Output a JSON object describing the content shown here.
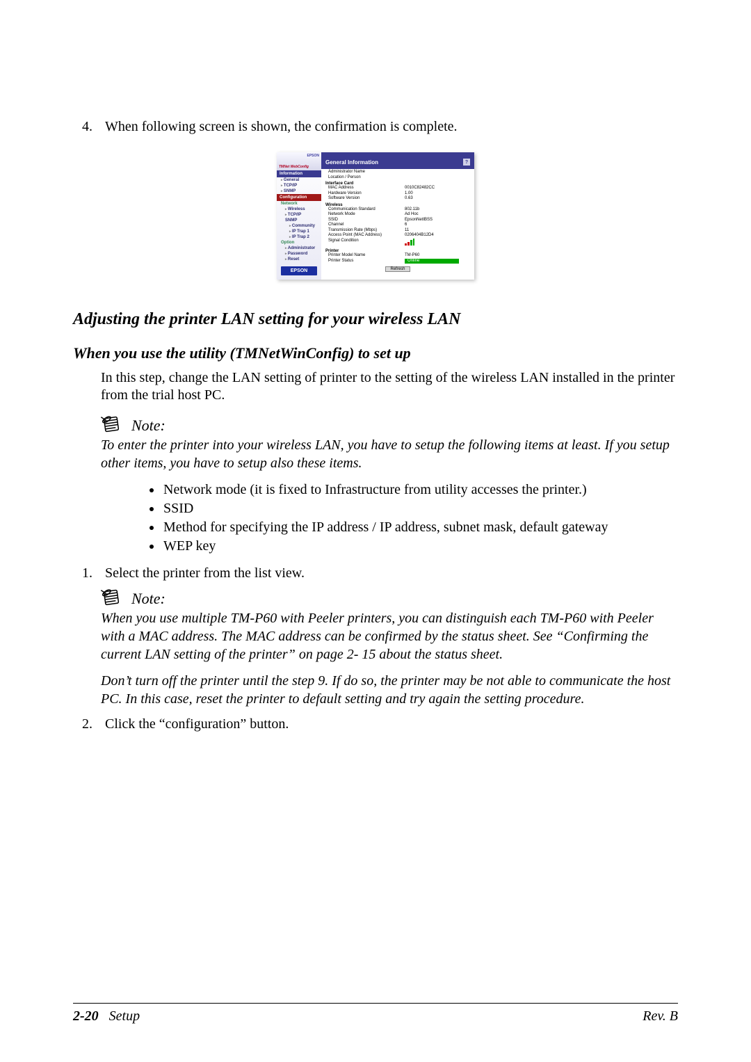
{
  "step4": {
    "num": "4.",
    "text": "When following screen is shown, the confirmation is complete."
  },
  "screenshot": {
    "logo_brand": "EPSON",
    "logo_product": "TMNet WebConfig",
    "side": {
      "info_h": "Information",
      "general": "General",
      "tcpip": "TCP/IP",
      "snmp": "SNMP",
      "config_h": "Configuration",
      "network": "Network",
      "wireless": "Wireless",
      "tcpip2": "TCP/IP",
      "snmp2": "SNMP",
      "community": "Community",
      "iptrap1": "IP Trap 1",
      "iptrap2": "IP Trap 2",
      "option": "Option",
      "admin": "Administrator",
      "password": "Password",
      "reset": "Reset"
    },
    "epson_badge": "EPSON",
    "title": "General Information",
    "help": "?",
    "admin_name_k": "Administrator Name",
    "location_k": "Location / Person",
    "iface_h": "Interface Card",
    "mac_k": "MAC Address",
    "mac_v": "0010C82482CC",
    "hw_k": "Hardware Version",
    "hw_v": "1.00",
    "sw_k": "Software Version",
    "sw_v": "0.63",
    "wl_h": "Wireless",
    "std_k": "Communication Standard",
    "std_v": "802.11b",
    "mode_k": "Network Mode",
    "mode_v": "Ad Hoc",
    "ssid_k": "SSID",
    "ssid_v": "EpsonNetIBSS",
    "ch_k": "Channel",
    "ch_v": "6",
    "rate_k": "Transmission Rate (Mbps)",
    "rate_v": "11",
    "ap_k": "Access Point (MAC Address)",
    "ap_v": "0206404B12D4",
    "sig_k": "Signal Condition",
    "pr_h": "Printer",
    "model_k": "Printer Model Name",
    "model_v": "TM-P60",
    "status_k": "Printer Status",
    "status_v": "Online",
    "refresh": "Refresh"
  },
  "h2": "Adjusting the printer LAN setting for your wireless LAN",
  "h3": "When you use the utility (TMNetWinConfig) to set up",
  "intro": "In this step, change the LAN setting of printer to the setting of the wireless LAN installed in the printer from the trial host PC.",
  "note1_label": "Note:",
  "note1_text": "To enter the printer into your wireless LAN, you have to setup the following items at least. If you setup other items, you have to setup also these items.",
  "bullets": {
    "b1": "Network mode (it is fixed to Infrastructure from utility accesses the printer.)",
    "b2": "SSID",
    "b3": "Method for specifying the IP address  / IP address, subnet mask, default gateway",
    "b4": "WEP key"
  },
  "step1": {
    "num": "1.",
    "text": "Select the printer from the list view."
  },
  "note2_label": "Note:",
  "note2_text1": "When you use multiple TM-P60 with Peeler printers, you can distinguish each TM-P60 with Peeler with a MAC address. The MAC address can be confirmed by the status sheet. See “Confirming the current LAN setting of the printer” on page 2- 15 about the status sheet.",
  "note2_text2": "Don’t turn off the printer until the step 9. If do so, the printer may be not able to communicate the host PC. In this case, reset the printer to default setting and try again the setting procedure.",
  "step2": {
    "num": "2.",
    "text": "Click the “configuration” button."
  },
  "footer": {
    "page": "2-20",
    "section": "Setup",
    "rev": "Rev. B"
  }
}
